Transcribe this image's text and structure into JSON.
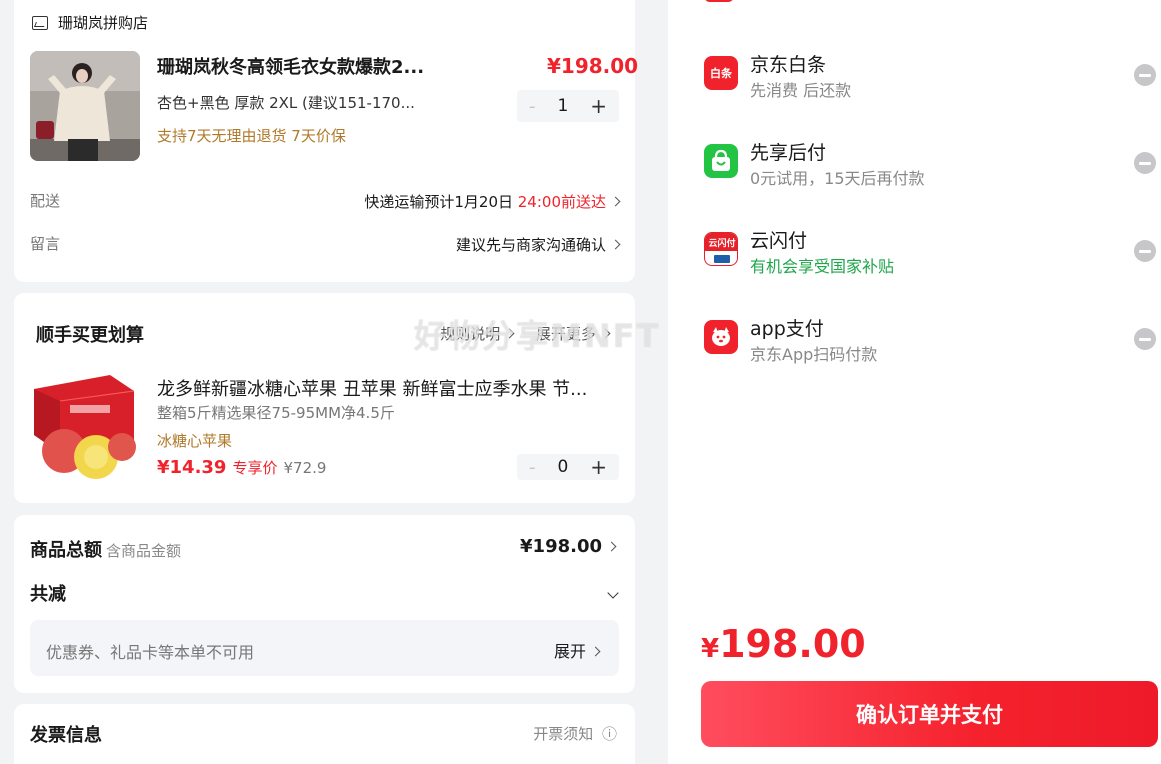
{
  "shop": {
    "name": "珊瑚岚拼购店"
  },
  "product": {
    "title": "珊瑚岚秋冬高领毛衣女款爆款2...",
    "spec": "杏色+黑色 厚款   2XL   (建议151-170...",
    "service": "支持7天无理由退货   7天价保",
    "price": "¥198.00",
    "quantity": "1",
    "minus": "-",
    "plus": "+"
  },
  "delivery": {
    "label": "配送",
    "value": "快递运输预计1月20日 ",
    "highlight": "24:00前送达"
  },
  "message": {
    "label": "留言",
    "value": "建议先与商家沟通确认"
  },
  "addon": {
    "title": "顺手买更划算",
    "rules": "规则说明",
    "more": "展开更多",
    "item": {
      "title": "龙多鲜新疆冰糖心苹果 丑苹果 新鲜富士应季水果 节...",
      "spec": "整箱5斤精选果径75-95MM净4.5斤",
      "tag": "冰糖心苹果",
      "price": "¥14.39",
      "price_tag": "专享价",
      "orig_price": "¥72.9",
      "quantity": "0",
      "minus": "-",
      "plus": "+"
    }
  },
  "summary": {
    "total_label": "商品总额",
    "total_sub": "含商品金额",
    "total_value": "¥198.00",
    "discount_label": "共减",
    "coupon_text": "优惠券、礼品卡等本单不可用",
    "coupon_action": "展开"
  },
  "invoice": {
    "title": "发票信息",
    "notice": "开票须知",
    "info_icon": "ⓘ"
  },
  "watermark": "好物分享MNFT",
  "payment_methods": [
    {
      "name": "京东白条",
      "desc": "先消费 后还款",
      "logo_text": "白条",
      "color": "#f0232d"
    },
    {
      "name": "先享后付",
      "desc": "0元试用，15天后再付款",
      "logo_text": "",
      "color": "#23c343"
    },
    {
      "name": "云闪付",
      "desc": "有机会享受国家补贴",
      "logo_text": "云闪付",
      "color": "#e6212a"
    },
    {
      "name": "app支付",
      "desc": "京东App扫码付款",
      "logo_text": "",
      "color": "#f0232d"
    }
  ],
  "checkout": {
    "total": "198.00",
    "currency": "¥",
    "button": "确认订单并支付"
  }
}
